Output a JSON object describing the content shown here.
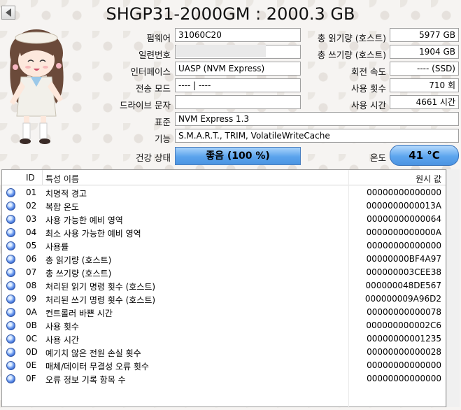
{
  "title": "SHGP31-2000GM : 2000.3 GB",
  "info": {
    "firmware_label": "펌웨어",
    "firmware": "31060C20",
    "serial_label": "일련번호",
    "interface_label": "인터페이스",
    "interface": "UASP (NVM Express)",
    "transfer_label": "전송 모드",
    "transfer": "---- | ----",
    "drive_letter_label": "드라이브 문자",
    "drive_letter": "",
    "standard_label": "표준",
    "standard": "NVM Express 1.3",
    "features_label": "기능",
    "features": "S.M.A.R.T., TRIM, VolatileWriteCache",
    "health_label": "건강 상태",
    "health": "좋음  (100 %)",
    "temp_label": "온도",
    "temp": "41 °C"
  },
  "right_info": {
    "total_reads_label": "총 읽기량 (호스트)",
    "total_reads": "5977 GB",
    "total_writes_label": "총 쓰기량 (호스트)",
    "total_writes": "1904 GB",
    "rotation_label": "회전 속도",
    "rotation": "---- (SSD)",
    "power_on_count_label": "사용 횟수",
    "power_on_count": "710 회",
    "power_on_hours_label": "사용 시간",
    "power_on_hours": "4661 시간"
  },
  "table": {
    "headers": {
      "id": "ID",
      "name": "특성 이름",
      "raw": "원시 값"
    },
    "rows": [
      {
        "id": "01",
        "name": "치명적 경고",
        "raw": "00000000000000"
      },
      {
        "id": "02",
        "name": "복합 온도",
        "raw": "0000000000013A"
      },
      {
        "id": "03",
        "name": "사용 가능한 예비 영역",
        "raw": "00000000000064"
      },
      {
        "id": "04",
        "name": "최소 사용 가능한 예비 영역",
        "raw": "0000000000000A"
      },
      {
        "id": "05",
        "name": "사용률",
        "raw": "00000000000000"
      },
      {
        "id": "06",
        "name": "총 읽기량 (호스트)",
        "raw": "00000000BF4A97"
      },
      {
        "id": "07",
        "name": "총 쓰기량 (호스트)",
        "raw": "000000003CEE38"
      },
      {
        "id": "08",
        "name": "처리된 읽기 명령 횟수 (호스트)",
        "raw": "000000048DE567"
      },
      {
        "id": "09",
        "name": "처리된 쓰기 명령 횟수 (호스트)",
        "raw": "000000009A96D2"
      },
      {
        "id": "0A",
        "name": "컨트롤러 바쁜 시간",
        "raw": "00000000000078"
      },
      {
        "id": "0B",
        "name": "사용 횟수",
        "raw": "000000000002C6"
      },
      {
        "id": "0C",
        "name": "사용 시간",
        "raw": "00000000001235"
      },
      {
        "id": "0D",
        "name": "예기치 않은 전원 손실 횟수",
        "raw": "00000000000028"
      },
      {
        "id": "0E",
        "name": "매체/데이터 무결성 오류 횟수",
        "raw": "00000000000000"
      },
      {
        "id": "0F",
        "name": "오류 정보 기록 항목 수",
        "raw": "00000000000000"
      }
    ]
  },
  "icons": {
    "prev": "triangle-left-icon",
    "status": "blue-circle-icon"
  },
  "colors": {
    "health_blue": "#5aa3ec",
    "status_dot": "#2e5dc8"
  }
}
